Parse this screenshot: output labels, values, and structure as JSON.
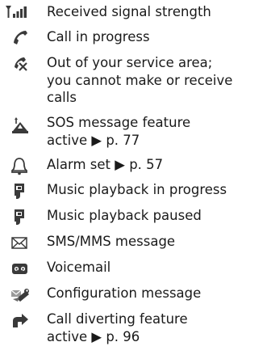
{
  "items": [
    {
      "icon": "signal-strength-icon",
      "text": "Received signal strength"
    },
    {
      "icon": "call-in-progress-icon",
      "text": "Call in progress"
    },
    {
      "icon": "out-of-service-icon",
      "text": "Out of your service area;\nyou cannot make or receive\ncalls"
    },
    {
      "icon": "sos-message-icon",
      "text": "SOS message feature\nactive ▶ p. 77"
    },
    {
      "icon": "alarm-bell-icon",
      "text": "Alarm set ▶ p. 57"
    },
    {
      "icon": "music-playing-icon",
      "text": "Music playback in progress"
    },
    {
      "icon": "music-paused-icon",
      "text": "Music playback paused"
    },
    {
      "icon": "envelope-icon",
      "text": "SMS/MMS message"
    },
    {
      "icon": "voicemail-icon",
      "text": "Voicemail"
    },
    {
      "icon": "configuration-message-icon",
      "text": "Configuration message"
    },
    {
      "icon": "call-divert-icon",
      "text": "Call diverting feature\nactive ▶ p. 96"
    }
  ]
}
